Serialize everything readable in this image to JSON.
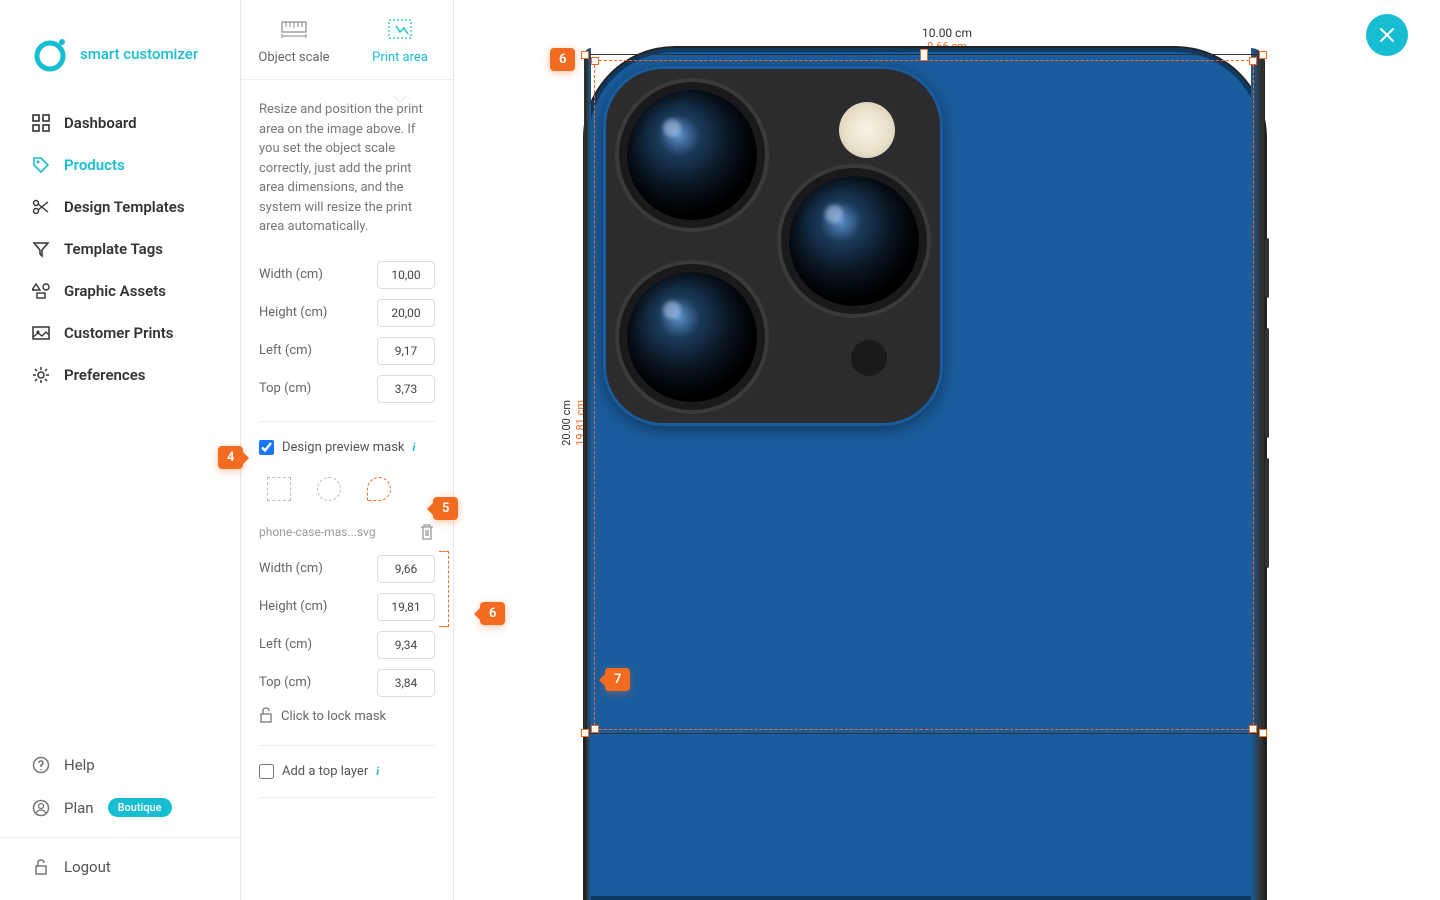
{
  "brand": "smart customizer",
  "nav": {
    "dashboard": "Dashboard",
    "products": "Products",
    "templates": "Design Templates",
    "tags": "Template Tags",
    "assets": "Graphic Assets",
    "prints": "Customer Prints",
    "prefs": "Preferences",
    "help": "Help",
    "plan": "Plan",
    "plan_badge": "Boutique",
    "logout": "Logout"
  },
  "tabs": {
    "scale": "Object scale",
    "print": "Print area"
  },
  "panel": {
    "desc": "Resize and position the print area on the image above. If you set the object scale correctly, just add the print area dimensions, and the system will resize the print area automatically.",
    "width_l": "Width (cm)",
    "height_l": "Height (cm)",
    "left_l": "Left (cm)",
    "top_l": "Top (cm)",
    "pa": {
      "width": "10,00",
      "height": "20,00",
      "left": "9,17",
      "top": "3,73"
    },
    "mask_check": "Design preview mask",
    "mask_file": "phone-case-mas...svg",
    "mask": {
      "width": "9,66",
      "height": "19,81",
      "left": "9,34",
      "top": "3,84"
    },
    "lock": "Click to lock mask",
    "top_layer": "Add a top layer"
  },
  "dims": {
    "w_cm": "10.00 cm",
    "w2_cm": "9.66 cm",
    "h_cm": "20.00 cm",
    "h2_cm": "19.81 cm"
  },
  "callouts": {
    "c4": "4",
    "c5": "5",
    "c6a": "6",
    "c6b": "6",
    "c7": "7"
  }
}
